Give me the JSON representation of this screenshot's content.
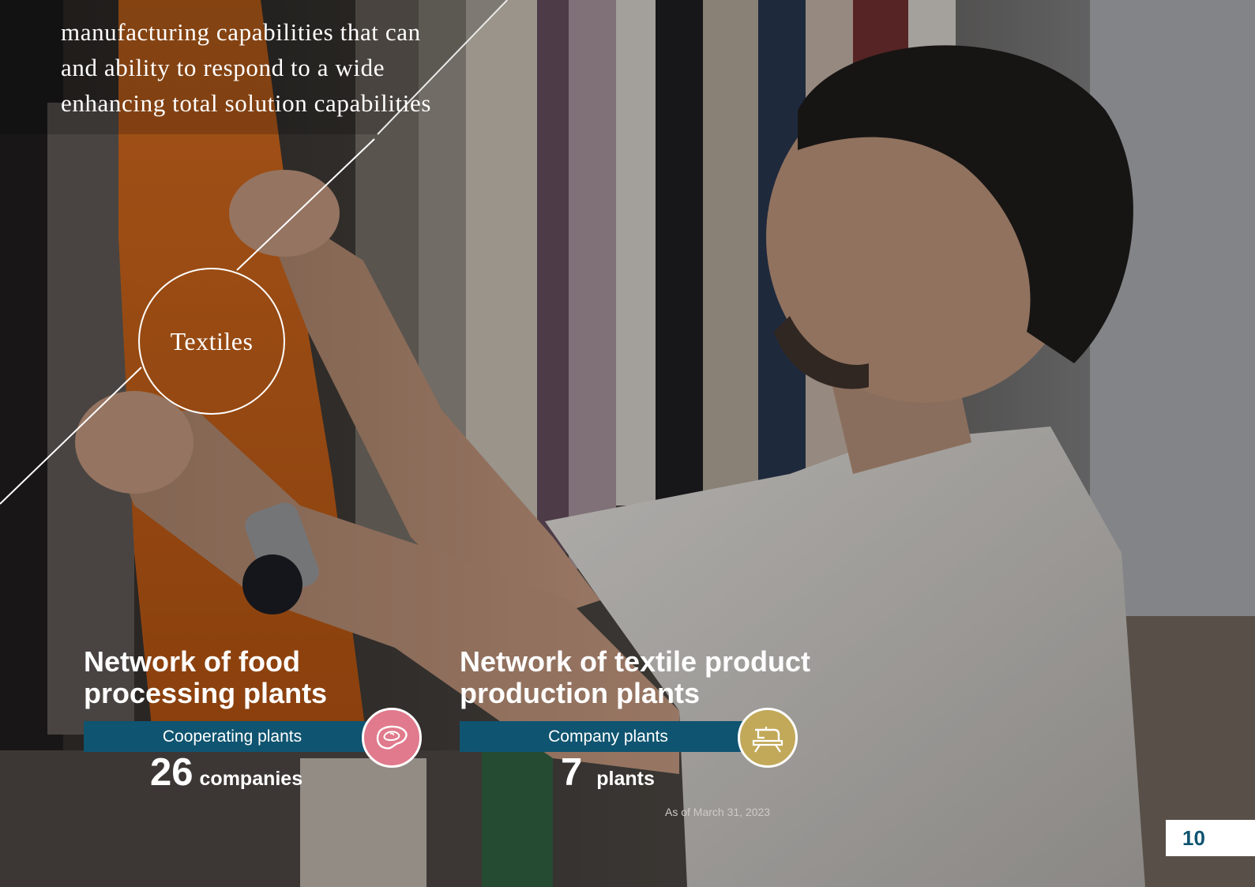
{
  "intro_lines": [
    "manufacturing capabilities that can",
    "and ability to respond to a wide",
    "enhancing total solution capabilities"
  ],
  "badge_label": "Textiles",
  "food": {
    "heading_line1": "Network of food",
    "heading_line2": "processing plants",
    "bar_label": "Cooperating plants",
    "icon": "meat-icon",
    "icon_color": "#e07a8c",
    "value": "26",
    "unit": "companies"
  },
  "textile": {
    "heading_line1": "Network of textile product",
    "heading_line2": "production plants",
    "bar_label": "Company plants",
    "icon": "sewing-machine-icon",
    "icon_color": "#c2a95a",
    "value": "7",
    "unit": "plants"
  },
  "as_of": "As of March 31, 2023",
  "page_number": "10",
  "colors": {
    "bar": "#0f5470",
    "text": "#ffffff"
  }
}
